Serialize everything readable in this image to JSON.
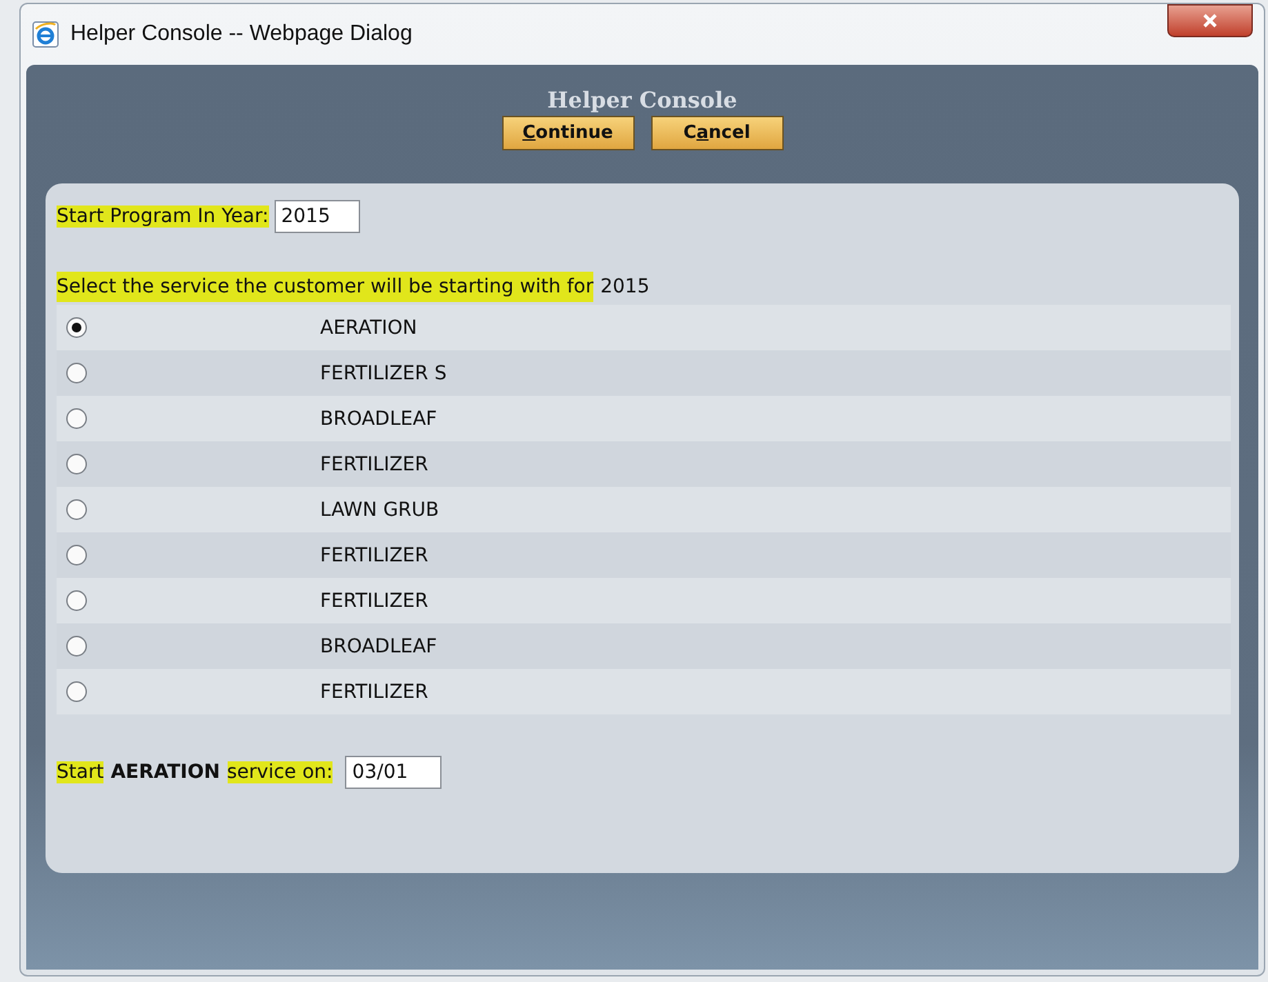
{
  "window": {
    "title": "Helper Console -- Webpage Dialog"
  },
  "header": {
    "title": "Helper Console"
  },
  "buttons": [
    {
      "mnemonic": "C",
      "after": "ontinue"
    },
    {
      "before": "C",
      "mnemonic": "a",
      "after": "ncel"
    }
  ],
  "year_field": {
    "label": "Start Program In Year:",
    "label_highlighted": true,
    "value": "2015"
  },
  "prompt": [
    {
      "text": "Select the service the customer will be starting with for",
      "highlighted": true,
      "bold": false
    },
    {
      "text": "2015",
      "highlighted": false,
      "bold": false
    }
  ],
  "services": [
    {
      "name": "AERATION",
      "selected": true
    },
    {
      "name": "FERTILIZER S",
      "selected": false
    },
    {
      "name": "BROADLEAF",
      "selected": false
    },
    {
      "name": "FERTILIZER",
      "selected": false
    },
    {
      "name": "LAWN GRUB",
      "selected": false
    },
    {
      "name": "FERTILIZER",
      "selected": false
    },
    {
      "name": "FERTILIZER",
      "selected": false
    },
    {
      "name": "BROADLEAF",
      "selected": false
    },
    {
      "name": "FERTILIZER",
      "selected": false
    }
  ],
  "start_line": {
    "parts": [
      {
        "text": "Start",
        "highlighted": true,
        "bold": false
      },
      {
        "text": "AERATION",
        "highlighted": false,
        "bold": true
      },
      {
        "text": "service on:",
        "highlighted": true,
        "bold": false
      }
    ],
    "value": "03/01"
  }
}
